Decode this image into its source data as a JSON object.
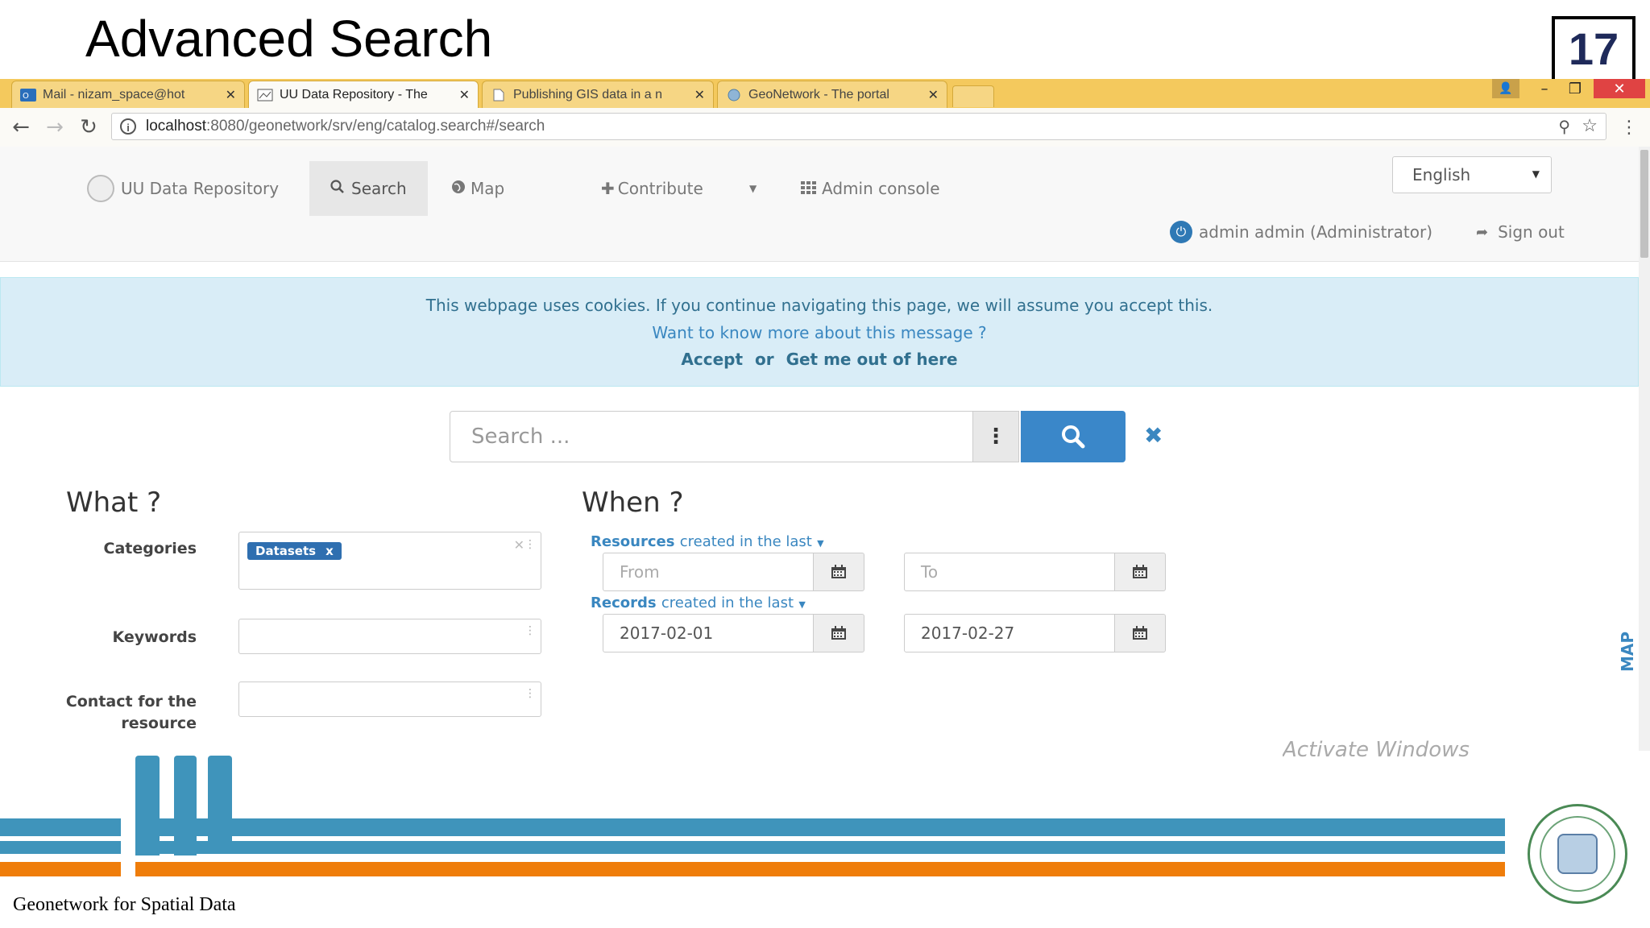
{
  "slide": {
    "title": "Advanced Search",
    "number": "17",
    "footer": "Geonetwork for Spatial Data"
  },
  "browser": {
    "tabs": [
      {
        "label": "Mail - nizam_space@hot",
        "icon": "outlook-icon",
        "active": false
      },
      {
        "label": "UU Data Repository - The",
        "icon": "map-favicon",
        "active": true
      },
      {
        "label": "Publishing GIS data in a n",
        "icon": "page-icon",
        "active": false
      },
      {
        "label": "GeoNetwork - The portal",
        "icon": "geonetwork-favicon",
        "active": false
      }
    ],
    "url_host": "localhost",
    "url_rest": ":8080/geonetwork/srv/eng/catalog.search#/search"
  },
  "app": {
    "brand": "UU Data Repository",
    "nav": {
      "search": "Search",
      "map": "Map",
      "contribute": "Contribute",
      "admin": "Admin console"
    },
    "language": "English",
    "user": "admin admin (Administrator)",
    "signout": "Sign out"
  },
  "cookie": {
    "message": "This webpage uses cookies. If you continue navigating this page, we will assume you accept this.",
    "more": "Want to know more about this message ?",
    "accept": "Accept",
    "or": "or",
    "getout": "Get me out of here"
  },
  "search": {
    "placeholder": "Search ..."
  },
  "what": {
    "heading": "What ?",
    "categories_label": "Categories",
    "category_tag": "Datasets",
    "keywords_label": "Keywords",
    "contact_label_1": "Contact for the",
    "contact_label_2": "resource"
  },
  "when": {
    "heading": "When ?",
    "resources_bold": "Resources",
    "resources_rest": "created in the last",
    "from_placeholder": "From",
    "to_placeholder": "To",
    "records_bold": "Records",
    "records_rest": "created in the last",
    "records_from": "2017-02-01",
    "records_to": "2017-02-27"
  },
  "map_tab": "MAP",
  "watermark": "Activate Windows",
  "colors": {
    "accent_blue": "#3a87c9",
    "band_blue": "#3f94bb",
    "band_orange": "#ef7d0a",
    "tab_bar": "#f4c95d"
  }
}
